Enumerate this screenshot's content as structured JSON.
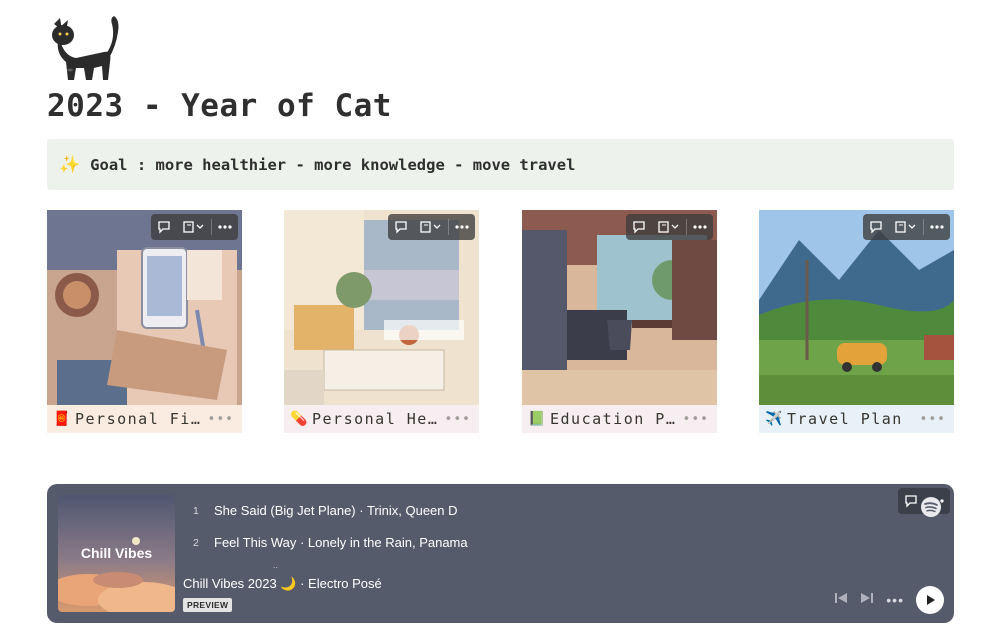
{
  "page": {
    "icon": "black-cat-emoji",
    "title": "2023 - Year of Cat"
  },
  "callout": {
    "icon": "sparkles-emoji",
    "text": "Goal : more healthier - more knowledge - move travel",
    "background": "#edf3ec"
  },
  "cards": [
    {
      "emoji": "🧧",
      "icon": "red-envelope-icon",
      "label": "Personal Fina…",
      "label_bg": "#fbece2"
    },
    {
      "emoji": "💊",
      "icon": "pill-icon",
      "label": "Personal Heal…",
      "label_bg": "#f7eef2"
    },
    {
      "emoji": "📗",
      "icon": "green-book-icon",
      "label": "Education Plan",
      "label_bg": "#f7eef2"
    },
    {
      "emoji": "✈️",
      "icon": "airplane-icon",
      "label": "Travel Plan",
      "label_bg": "#e7f1f7"
    }
  ],
  "card_more": "•••",
  "player": {
    "art_title": "Chill Vibes",
    "tracks": [
      {
        "num": "1",
        "title": "She Said (Big Jet Plane) · Trinix, Queen D"
      },
      {
        "num": "2",
        "title": "Feel This Way · Lonely in the Rain, Panama"
      }
    ],
    "ellipsis": "..",
    "album": "Chill Vibes 2023 🌙 · Electro Posé",
    "badge": "PREVIEW",
    "more": "•••",
    "background": "#565b6b"
  }
}
